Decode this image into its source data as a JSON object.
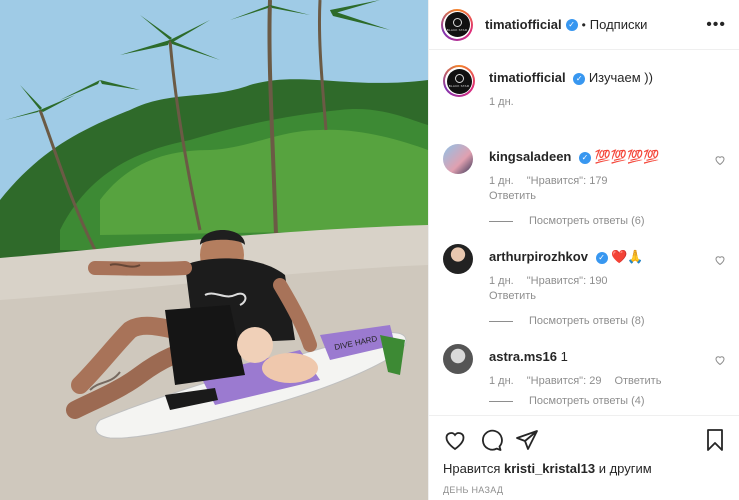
{
  "post": {
    "author": "timatiofficial",
    "follow_state": "Подписки",
    "dot": "•",
    "avatar_text": "BLACK STAR",
    "caption": "Изучаем ))",
    "caption_time": "1 дн.",
    "likes_prefix": "Нравится",
    "likes_user": "kristi_kristal13",
    "likes_suffix": "и другим",
    "time_ago": "ДЕНЬ НАЗАД"
  },
  "comments": [
    {
      "user": "kingsaladeen",
      "verified": true,
      "text": "💯💯💯💯",
      "time": "1 дн.",
      "likes": "\"Нравится\": 179",
      "reply": "Ответить",
      "view_replies": "Посмотреть ответы (6)"
    },
    {
      "user": "arthurpirozhkov",
      "verified": true,
      "text": "❤️🙏",
      "time": "1 дн.",
      "likes": "\"Нравится\": 190",
      "reply": "Ответить",
      "view_replies": "Посмотреть ответы (8)"
    },
    {
      "user": "astra.ms16",
      "verified": false,
      "text": "1",
      "time": "1 дн.",
      "likes": "\"Нравится\": 29",
      "reply": "Ответить",
      "view_replies": "Посмотреть ответы (4)"
    }
  ],
  "photo": {
    "board_text": "DIVE HARD"
  },
  "colors": {
    "verified": "#3897f0",
    "muted": "#8e8e8e",
    "heart": "#ed4956"
  },
  "icons": [
    "heart-icon",
    "comment-icon",
    "share-icon",
    "bookmark-icon",
    "more-icon"
  ]
}
